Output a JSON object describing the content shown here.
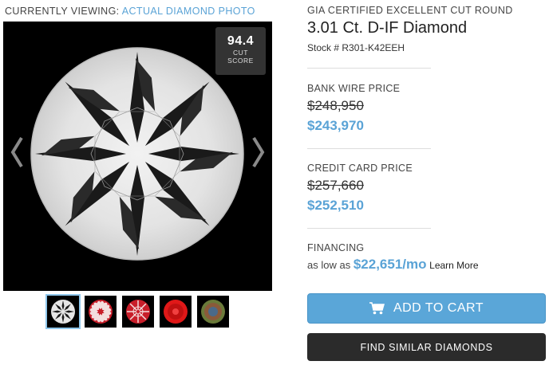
{
  "viewing": {
    "prefix": "CURRENTLY VIEWING:",
    "mode": "ACTUAL DIAMOND PHOTO"
  },
  "score": {
    "value": "94.4",
    "line1": "CUT",
    "line2": "SCORE"
  },
  "product": {
    "certification": "GIA CERTIFIED EXCELLENT CUT ROUND",
    "title": "3.01 Ct. D-IF Diamond",
    "stock": "Stock # R301-K42EEH"
  },
  "bank_wire": {
    "label": "BANK WIRE PRICE",
    "old_price": "$248,950",
    "price": "$243,970"
  },
  "credit_card": {
    "label": "CREDIT CARD PRICE",
    "old_price": "$257,660",
    "price": "$252,510"
  },
  "financing": {
    "label": "FINANCING",
    "prefix": "as low as",
    "amount": "$22,651/mo",
    "link": "Learn More"
  },
  "buttons": {
    "add_to_cart": "ADD TO CART",
    "find_similar": "FIND SIMILAR DIAMONDS"
  },
  "thumbnails": [
    "diamond-photo",
    "hearts-view",
    "arrows-view",
    "ideal-scope",
    "aset-scope"
  ],
  "colors": {
    "accent": "#5aa3d6",
    "cart_button": "#5aa6d8",
    "dark_button": "#2b2b2b"
  }
}
